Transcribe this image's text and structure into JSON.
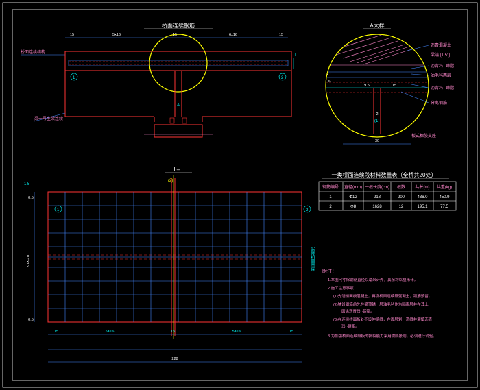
{
  "titles": {
    "elevation": "桥面连续钢筋",
    "detail": "A大样",
    "table": "一类桥面连续段材料数量表（全桥共20处）"
  },
  "dims": {
    "elev_left": "15",
    "elev_span1": "5x16",
    "elev_mid": "15",
    "elev_span2": "6x16",
    "elev_right": "15",
    "plan_left": "15",
    "plan_span1": "5X16",
    "plan_mid": "15",
    "plan_span2": "5X16",
    "plan_right": "15",
    "plan_h1": "0.5",
    "plan_h2": "105x15",
    "plan_h3": "0.5",
    "plan_total": "228",
    "detail_w": "30",
    "detail_15": "15",
    "detail_95": "9.5",
    "detail_21": "2.1",
    "detail_2": "2"
  },
  "labels": {
    "section": "I – I",
    "callout1": "1",
    "callout2": "2",
    "leader_left": "桥面连续结构",
    "hatch_label": "沥青混凝土",
    "d_layer1": "沥青玛··蹄脂",
    "d_layer2": "油毛毡两层",
    "d_layer3": "沥青玛··蹄脂",
    "d_layer4": "分离钢筋",
    "d_layer5": "板式橡胶支座",
    "arrow_a": "A",
    "arrow_i": "I",
    "f1_label": "(1)",
    "f2_label": "(2)",
    "plan_right_label": "实际桥面宽度"
  },
  "table": {
    "headers": [
      "钢筋编号",
      "直径(mm)",
      "一根长度(cm)",
      "根数",
      "共长(m)",
      "共重(kg)"
    ],
    "rows": [
      [
        "1",
        "Φ12",
        "218",
        "200",
        "436.0",
        "450.9"
      ],
      [
        "2",
        "Φ8",
        "1628",
        "12",
        "195.1",
        "77.5"
      ]
    ]
  },
  "notes": {
    "title": "附注：",
    "n1": "1.本图尺寸除钢筋直径以毫米计外，其余均以厘米计。",
    "n2": "2.施工注意事项：",
    "n21": "(1)先浇桥面板混凝土，再浇桥面连续段混凝土，钢筋预留。",
    "n22": "(2)铺设钢筋前先在梁顶铺一层油毛毡作为隔离层并在其上",
    "n22b": "面涂沥青玛··蹄脂。",
    "n23": "(3)在连续桥面板处不设伸缩缝，在面层划一道缝并灌填沥青",
    "n23b": "玛··蹄脂。",
    "n3": "3.为加强桥面连续段板的抗裂能力采用微膨胀剂，必须进行试验。"
  },
  "chart_data": {
    "type": "table",
    "title": "一类桥面连续段材料数量表（全桥共20处）",
    "columns": [
      "钢筋编号",
      "直径(mm)",
      "一根长度(cm)",
      "根数",
      "共长(m)",
      "共重(kg)"
    ],
    "rows": [
      [
        "1",
        "Φ12",
        "218",
        "200",
        "436.0",
        "450.9"
      ],
      [
        "2",
        "Φ8",
        "1628",
        "12",
        "195.1",
        "77.5"
      ]
    ]
  }
}
